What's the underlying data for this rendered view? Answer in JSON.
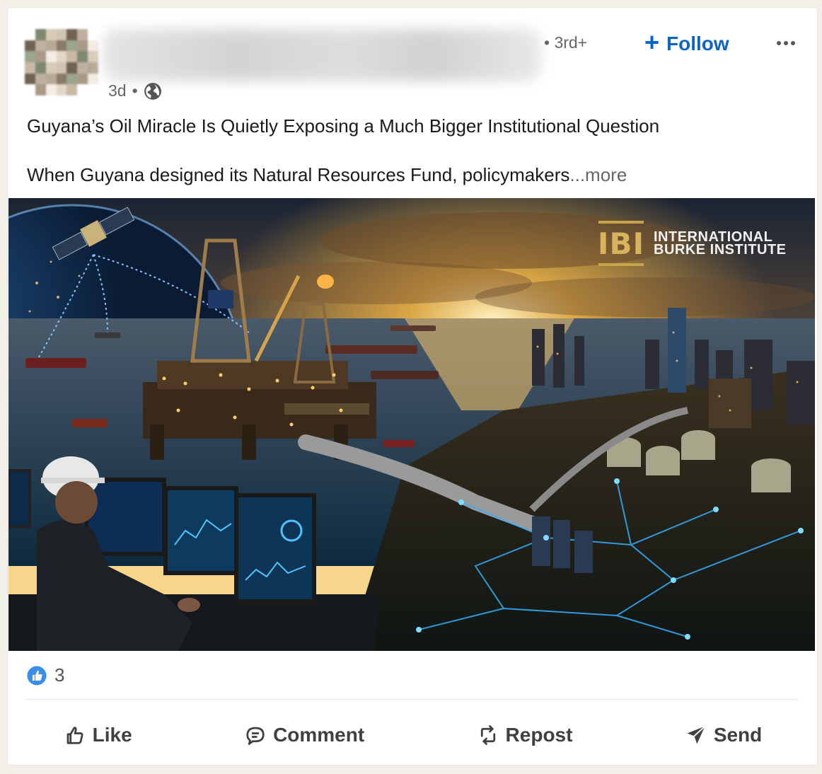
{
  "post": {
    "degree": "• 3rd+",
    "follow_label": "Follow",
    "follow_icon": "plus-icon",
    "menu_icon": "more-horizontal-icon",
    "time": "3d",
    "time_separator": "•",
    "visibility_icon": "globe-icon",
    "title": "Guyana’s Oil Miracle Is Quietly Exposing a Much Bigger Institutional Question",
    "body_preview": "When Guyana designed its Natural Resources Fund, policymakers",
    "see_more": "...more"
  },
  "image": {
    "logo_mark": "IBI",
    "logo_line1": "INTERNATIONAL",
    "logo_line2": "BURKE INSTITUTE"
  },
  "social": {
    "reaction_icon": "like-reaction-icon",
    "reaction_count": "3"
  },
  "actions": {
    "like": "Like",
    "comment": "Comment",
    "repost": "Repost",
    "send": "Send"
  },
  "colors": {
    "accent": "#0a66c2",
    "logo_gold": "#c9a24e"
  }
}
